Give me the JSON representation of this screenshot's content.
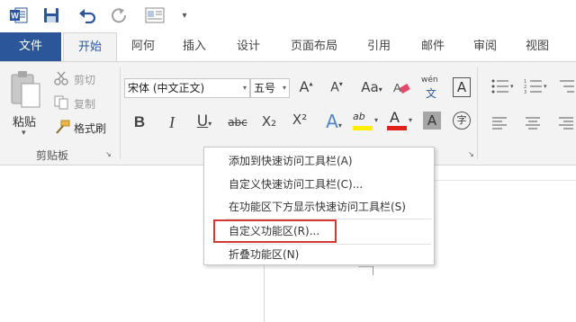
{
  "quick_access": {
    "word_logo": "W",
    "save_icon": "save-icon",
    "undo_icon": "undo-icon",
    "redo_icon": "redo-icon",
    "print_preview_icon": "print-preview-icon",
    "customize_arrow": "▾"
  },
  "tabs": [
    {
      "label": "文件"
    },
    {
      "label": "开始"
    },
    {
      "label": "阿何"
    },
    {
      "label": "插入"
    },
    {
      "label": "设计"
    },
    {
      "label": "页面布局"
    },
    {
      "label": "引用"
    },
    {
      "label": "邮件"
    },
    {
      "label": "审阅"
    },
    {
      "label": "视图"
    }
  ],
  "clipboard": {
    "paste_label": "粘贴",
    "cut_label": "剪切",
    "copy_label": "复制",
    "format_painter_label": "格式刷",
    "group_label": "剪贴板"
  },
  "font": {
    "font_name": "宋体 (中文正文)",
    "font_size": "五号",
    "grow": "A",
    "shrink": "A",
    "case": "Aa",
    "phonetic_top": "wén",
    "phonetic_bottom": "文",
    "char_border": "A",
    "bold": "B",
    "italic": "I",
    "underline": "U",
    "strikethrough": "abc",
    "subscript": "X₂",
    "superscript": "X²",
    "text_effect": "A",
    "highlight": "ab",
    "font_color": "A",
    "char_shading": "A",
    "enclose": "字"
  },
  "colors": {
    "file_tab": "#2b579a",
    "accent": "#2b579a",
    "highlight_yellow": "#ffee00",
    "font_color_red": "#e0201a",
    "menu_highlight_border": "#d03a33"
  },
  "context_menu": {
    "items": [
      {
        "label": "添加到快速访问工具栏(A)"
      },
      {
        "label": "自定义快速访问工具栏(C)..."
      },
      {
        "label": "在功能区下方显示快速访问工具栏(S)"
      },
      {
        "label": "自定义功能区(R)..."
      },
      {
        "label": "折叠功能区(N)"
      }
    ]
  }
}
